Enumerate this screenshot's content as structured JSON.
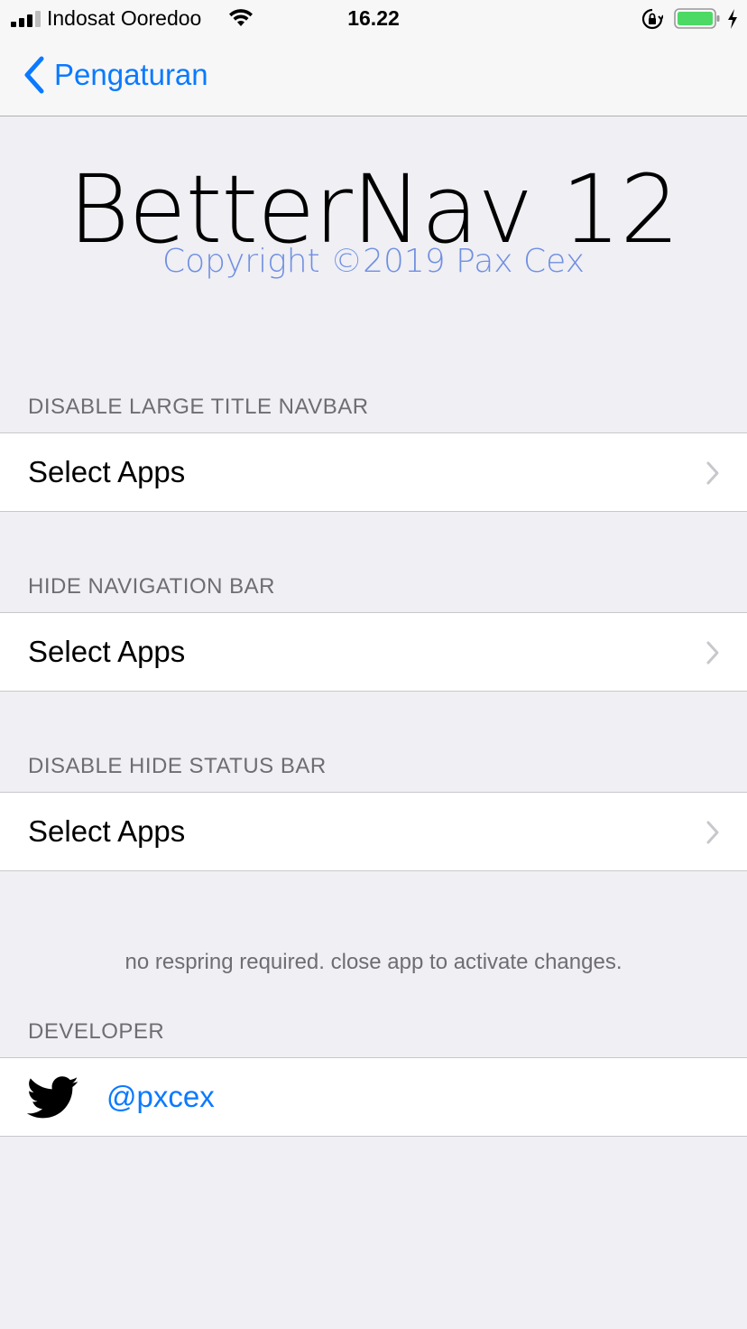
{
  "status_bar": {
    "carrier": "Indosat Ooredoo",
    "time": "16.22",
    "battery_color": "#4cd964",
    "icons": [
      "signal-icon",
      "wifi-icon",
      "orientation-lock-icon",
      "battery-icon",
      "charging-bolt-icon"
    ]
  },
  "navbar": {
    "back_label": "Pengaturan",
    "accent_color": "#0a7aff"
  },
  "banner": {
    "title": "BetterNav 12",
    "copyright": "Copyright ©2019 Pax Cex"
  },
  "sections": [
    {
      "header": "DISABLE LARGE TITLE NAVBAR",
      "cell_label": "Select Apps"
    },
    {
      "header": "HIDE NAVIGATION BAR",
      "cell_label": "Select Apps"
    },
    {
      "header": "DISABLE HIDE STATUS BAR",
      "cell_label": "Select Apps"
    }
  ],
  "footer_note": "no respring required. close app to activate changes.",
  "developer": {
    "header": "DEVELOPER",
    "handle": "@pxcex",
    "icon": "twitter-icon"
  }
}
